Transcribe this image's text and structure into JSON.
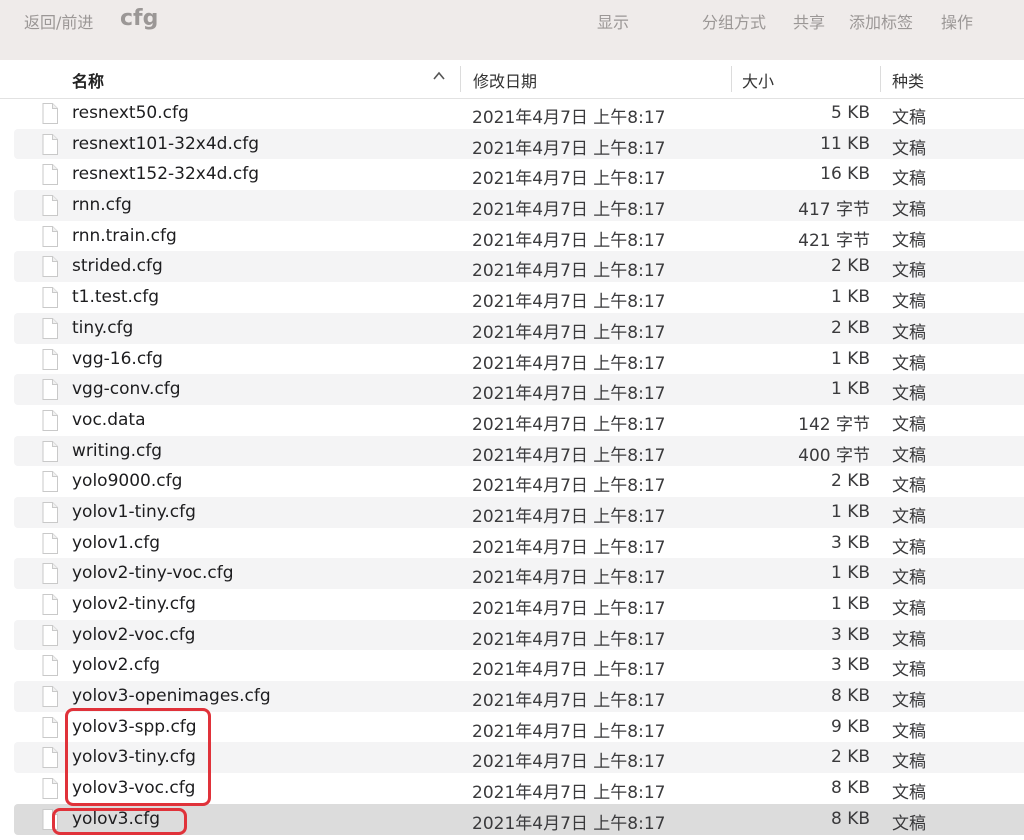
{
  "toolbar": {
    "back_forward": "返回/前进",
    "folder_title": "cfg",
    "view_label": "显示",
    "group_label": "分组方式",
    "share_label": "共享",
    "tags_label": "添加标签",
    "action_label": "操作"
  },
  "columns": {
    "name": "名称",
    "date": "修改日期",
    "size": "大小",
    "kind": "种类"
  },
  "files": [
    {
      "name": "resnext50.cfg",
      "date": "2021年4月7日 上午8:17",
      "size": "5 KB",
      "kind": "文稿"
    },
    {
      "name": "resnext101-32x4d.cfg",
      "date": "2021年4月7日 上午8:17",
      "size": "11 KB",
      "kind": "文稿"
    },
    {
      "name": "resnext152-32x4d.cfg",
      "date": "2021年4月7日 上午8:17",
      "size": "16 KB",
      "kind": "文稿"
    },
    {
      "name": "rnn.cfg",
      "date": "2021年4月7日 上午8:17",
      "size": "417 字节",
      "kind": "文稿"
    },
    {
      "name": "rnn.train.cfg",
      "date": "2021年4月7日 上午8:17",
      "size": "421 字节",
      "kind": "文稿"
    },
    {
      "name": "strided.cfg",
      "date": "2021年4月7日 上午8:17",
      "size": "2 KB",
      "kind": "文稿"
    },
    {
      "name": "t1.test.cfg",
      "date": "2021年4月7日 上午8:17",
      "size": "1 KB",
      "kind": "文稿"
    },
    {
      "name": "tiny.cfg",
      "date": "2021年4月7日 上午8:17",
      "size": "2 KB",
      "kind": "文稿"
    },
    {
      "name": "vgg-16.cfg",
      "date": "2021年4月7日 上午8:17",
      "size": "1 KB",
      "kind": "文稿"
    },
    {
      "name": "vgg-conv.cfg",
      "date": "2021年4月7日 上午8:17",
      "size": "1 KB",
      "kind": "文稿"
    },
    {
      "name": "voc.data",
      "date": "2021年4月7日 上午8:17",
      "size": "142 字节",
      "kind": "文稿"
    },
    {
      "name": "writing.cfg",
      "date": "2021年4月7日 上午8:17",
      "size": "400 字节",
      "kind": "文稿"
    },
    {
      "name": "yolo9000.cfg",
      "date": "2021年4月7日 上午8:17",
      "size": "2 KB",
      "kind": "文稿"
    },
    {
      "name": "yolov1-tiny.cfg",
      "date": "2021年4月7日 上午8:17",
      "size": "1 KB",
      "kind": "文稿"
    },
    {
      "name": "yolov1.cfg",
      "date": "2021年4月7日 上午8:17",
      "size": "3 KB",
      "kind": "文稿"
    },
    {
      "name": "yolov2-tiny-voc.cfg",
      "date": "2021年4月7日 上午8:17",
      "size": "1 KB",
      "kind": "文稿"
    },
    {
      "name": "yolov2-tiny.cfg",
      "date": "2021年4月7日 上午8:17",
      "size": "1 KB",
      "kind": "文稿"
    },
    {
      "name": "yolov2-voc.cfg",
      "date": "2021年4月7日 上午8:17",
      "size": "3 KB",
      "kind": "文稿"
    },
    {
      "name": "yolov2.cfg",
      "date": "2021年4月7日 上午8:17",
      "size": "3 KB",
      "kind": "文稿"
    },
    {
      "name": "yolov3-openimages.cfg",
      "date": "2021年4月7日 上午8:17",
      "size": "8 KB",
      "kind": "文稿"
    },
    {
      "name": "yolov3-spp.cfg",
      "date": "2021年4月7日 上午8:17",
      "size": "9 KB",
      "kind": "文稿"
    },
    {
      "name": "yolov3-tiny.cfg",
      "date": "2021年4月7日 上午8:17",
      "size": "2 KB",
      "kind": "文稿"
    },
    {
      "name": "yolov3-voc.cfg",
      "date": "2021年4月7日 上午8:17",
      "size": "8 KB",
      "kind": "文稿"
    },
    {
      "name": "yolov3.cfg",
      "date": "2021年4月7日 上午8:17",
      "size": "8 KB",
      "kind": "文稿",
      "selected": true
    }
  ],
  "colors": {
    "toolbar_bg": "#efebea",
    "alt_row": "#f4f4f5",
    "selected_row": "#dcdcdc",
    "annotation_red": "#e0323a"
  }
}
